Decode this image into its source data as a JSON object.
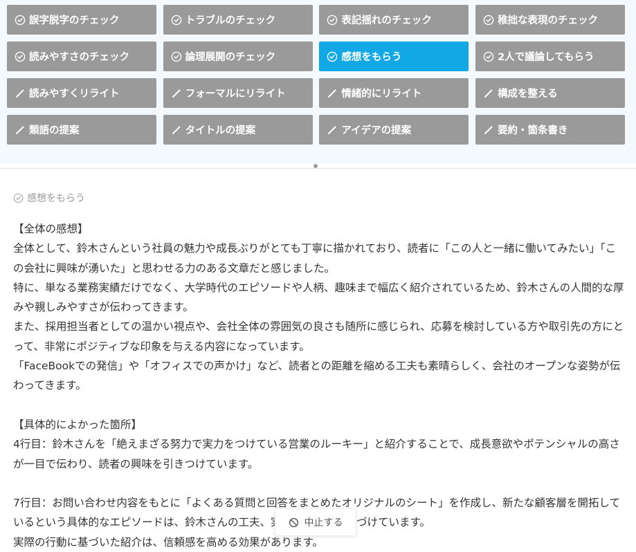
{
  "tools": [
    {
      "label": "誤字脱字のチェック",
      "icon": "check-circle-icon",
      "name": "typo-check"
    },
    {
      "label": "トラブルのチェック",
      "icon": "check-circle-icon",
      "name": "trouble-check"
    },
    {
      "label": "表記揺れのチェック",
      "icon": "check-circle-icon",
      "name": "notation-check"
    },
    {
      "label": "稚拙な表現のチェック",
      "icon": "check-circle-icon",
      "name": "immature-expression-check"
    },
    {
      "label": "読みやすさのチェック",
      "icon": "check-circle-icon",
      "name": "readability-check"
    },
    {
      "label": "論理展開のチェック",
      "icon": "check-circle-icon",
      "name": "logic-check"
    },
    {
      "label": "感想をもらう",
      "icon": "check-circle-icon",
      "name": "get-feedback",
      "active": true
    },
    {
      "label": "2人で議論してもらう",
      "icon": "check-circle-icon",
      "name": "two-person-discussion"
    },
    {
      "label": "読みやすくリライト",
      "icon": "pencil-icon",
      "name": "rewrite-readable"
    },
    {
      "label": "フォーマルにリライト",
      "icon": "pencil-icon",
      "name": "rewrite-formal"
    },
    {
      "label": "情緒的にリライト",
      "icon": "pencil-icon",
      "name": "rewrite-emotional"
    },
    {
      "label": "構成を整える",
      "icon": "pencil-icon",
      "name": "organize-structure"
    },
    {
      "label": "類語の提案",
      "icon": "pencil-icon",
      "name": "suggest-synonyms"
    },
    {
      "label": "タイトルの提案",
      "icon": "pencil-icon",
      "name": "suggest-title"
    },
    {
      "label": "アイデアの提案",
      "icon": "pencil-icon",
      "name": "suggest-ideas"
    },
    {
      "label": "要約・箇条書き",
      "icon": "pencil-icon",
      "name": "summarize-bullets"
    }
  ],
  "result": {
    "icon": "check-circle-icon",
    "title": "感想をもらう",
    "paragraphs": [
      "【全体の感想】",
      "全体として、鈴木さんという社員の魅力や成長ぶりがとても丁寧に描かれており、読者に「この人と一緒に働いてみたい」「この会社に興味が湧いた」と思わせる力のある文章だと感じました。",
      "特に、単なる業務実績だけでなく、大学時代のエピソードや人柄、趣味まで幅広く紹介されているため、鈴木さんの人間的な厚みや親しみやすさが伝わってきます。",
      "また、採用担当者としての温かい視点や、会社全体の雰囲気の良さも随所に感じられ、応募を検討している方や取引先の方にとって、非常にポジティブな印象を与える内容になっています。",
      "「FaceBookでの発信」や「オフィスでの声かけ」など、読者との距離を縮める工夫も素晴らしく、会社のオープンな姿勢が伝わってきます。",
      "",
      "【具体的によかった箇所】",
      "4行目：鈴木さんを「絶えまざる努力で実力をつけている営業のルーキー」と紹介することで、成長意欲やポテンシャルの高さが一目で伝わり、読者の興味を引きつけています。",
      "",
      "7行目：お問い合わせ内容をもとに「よくある質問と回答をまとめたオリジナルのシート」を作成し、新たな顧客層を開拓しているという具体的なエピソードは、鈴木さんの工夫、実行力を強く印象づけています。",
      "実際の行動に基づいた紹介は、信頼感を高める効果があります。"
    ]
  },
  "stop_button": {
    "label": "中止する",
    "icon": "prohibited-icon"
  }
}
